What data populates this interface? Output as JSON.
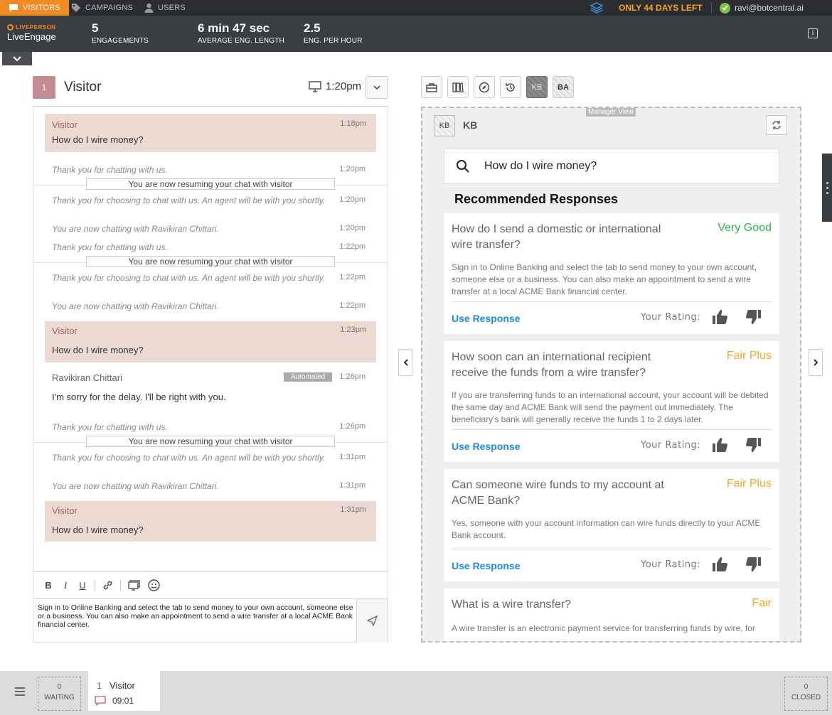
{
  "topnav": {
    "tabs": [
      "VISITORS",
      "CAMPAIGNS",
      "USERS"
    ],
    "trial": "ONLY 44 DAYS LEFT",
    "user_email": "ravi@botcentral.ai"
  },
  "header": {
    "logo_top": "LIVEPERSON",
    "logo_bottom": "LiveEngage",
    "stats": [
      {
        "value": "5",
        "label": "ENGAGEMENTS"
      },
      {
        "value": "6 min 47 sec",
        "label": "AVERAGE ENG. LENGTH"
      },
      {
        "value": "2.5",
        "label": "ENG. PER HOUR"
      }
    ],
    "info_glyph": "i"
  },
  "chat": {
    "badge": "1",
    "title": "Visitor",
    "time": "1:20pm",
    "messages": {
      "v1": {
        "name": "Visitor",
        "time": "1:18pm",
        "text": "How do I wire money?"
      },
      "s1": {
        "text": "Thank you for chatting with us.",
        "time": "1:20pm"
      },
      "r1": "You are now resuming your chat with visitor",
      "s2": {
        "text": "Thank you for choosing to chat with us. An agent will be with you shortly.",
        "time": "1:20pm"
      },
      "s3": {
        "text": "You are now chatting with Ravikiran Chittari.",
        "time": "1:20pm"
      },
      "s4": {
        "text": "Thank you for chatting with us.",
        "time": "1:22pm"
      },
      "r2": "You are now resuming your chat with visitor",
      "s5": {
        "text": "Thank you for choosing to chat with us. An agent will be with you shortly.",
        "time": "1:22pm"
      },
      "s6": {
        "text": "You are now chatting with Ravikiran Chittari.",
        "time": "1:22pm"
      },
      "v2": {
        "name": "Visitor",
        "time": "1:23pm",
        "text": "How do I wire money?"
      },
      "a1": {
        "name": "Ravikiran Chittari",
        "tag": "Automated",
        "time": "1:26pm",
        "text": "I'm sorry for the delay. I'll be right with you."
      },
      "s7": {
        "text": "Thank you for chatting with us.",
        "time": "1:26pm"
      },
      "r3": "You are now resuming your chat with visitor",
      "s8": {
        "text": "Thank you for choosing to chat with us. An agent will be with you shortly.",
        "time": "1:31pm"
      },
      "s9": {
        "text": "You are now chatting with Ravikiran Chittari.",
        "time": "1:31pm"
      },
      "v3": {
        "name": "Visitor",
        "time": "1:31pm",
        "text": "How do I wire money?"
      }
    },
    "editor": {
      "bold": "B",
      "italic": "I",
      "underline": "U"
    },
    "input_text": "Sign in to Online Banking and select the tab to send money to your own account, someone else or a business. You can also make an appointment to send a wire transfer at a local ACME Bank financial center."
  },
  "widgets": {
    "kb": "KB",
    "ba": "BA"
  },
  "kb": {
    "manager_view": "Manager View",
    "icon": "KB",
    "title": "KB",
    "query": "How do I wire money?",
    "section_title": "Recommended Responses",
    "use_label": "Use Response",
    "rating_label": "Your Rating:",
    "cards": [
      {
        "question": "How do I send a domestic or international wire transfer?",
        "score": "Very Good",
        "score_color": "#2bb34b",
        "answer": "Sign in to Online Banking and select the tab to send money to your own account, someone else or a business. You can also make an appointment to send a wire transfer at a local ACME Bank financial center."
      },
      {
        "question": "How soon can an international recipient receive the funds from a wire transfer?",
        "score": "Fair Plus",
        "score_color": "#f5a623",
        "answer": "If you are transferring funds to an international account, your account will be debited the same day and ACME Bank will send the payment out immediately. The beneficiary's bank will generally receive the funds 1 to 2 days later."
      },
      {
        "question": "Can someone wire funds to my account at ACME Bank?",
        "score": "Fair Plus",
        "score_color": "#f5a623",
        "answer": "Yes, someone with your account information can wire funds directly to your ACME Bank account."
      },
      {
        "question": "What is a wire transfer?",
        "score": "Fair",
        "score_color": "#f5a623",
        "answer": "A wire transfer is an electronic payment service for transferring funds by wire, for"
      }
    ]
  },
  "bottom": {
    "waiting_count": "0",
    "waiting_label": "WAITING",
    "closed_count": "0",
    "closed_label": "CLOSED",
    "tab_num": "1",
    "tab_name": "Visitor",
    "tab_time": "09:01"
  }
}
